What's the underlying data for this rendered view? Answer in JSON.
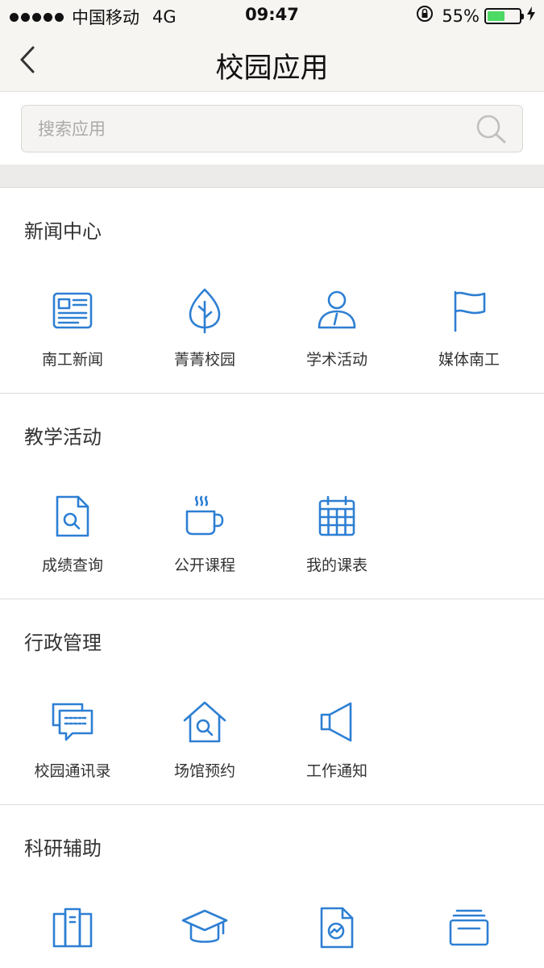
{
  "status_bar": {
    "carrier": "中国移动",
    "network": "4G",
    "time": "09:47",
    "battery_text": "55%",
    "battery_level": 0.55,
    "battery_color": "#4cd964"
  },
  "nav": {
    "title": "校园应用",
    "back_icon": "chevron-left-icon"
  },
  "search": {
    "placeholder": "搜索应用",
    "value": "",
    "icon": "search-icon"
  },
  "colors": {
    "accent": "#2d7fd3",
    "header_bg": "#f7f5f2",
    "divider_band": "#edebe9"
  },
  "sections": [
    {
      "title": "新闻中心",
      "items": [
        {
          "label": "南工新闻",
          "icon": "newspaper-icon"
        },
        {
          "label": "菁菁校园",
          "icon": "leaf-icon"
        },
        {
          "label": "学术活动",
          "icon": "lecturer-icon"
        },
        {
          "label": "媒体南工",
          "icon": "flag-icon"
        }
      ]
    },
    {
      "title": "教学活动",
      "items": [
        {
          "label": "成绩查询",
          "icon": "document-search-icon"
        },
        {
          "label": "公开课程",
          "icon": "coffee-cup-icon"
        },
        {
          "label": "我的课表",
          "icon": "calendar-icon"
        }
      ]
    },
    {
      "title": "行政管理",
      "items": [
        {
          "label": "校园通讯录",
          "icon": "chat-bubbles-icon"
        },
        {
          "label": "场馆预约",
          "icon": "house-search-icon"
        },
        {
          "label": "工作通知",
          "icon": "speaker-icon"
        }
      ]
    },
    {
      "title": "科研辅助",
      "items": [
        {
          "label": "",
          "icon": "books-icon"
        },
        {
          "label": "",
          "icon": "graduation-cap-icon"
        },
        {
          "label": "",
          "icon": "report-chart-icon"
        },
        {
          "label": "",
          "icon": "stacked-cards-icon"
        }
      ]
    }
  ]
}
